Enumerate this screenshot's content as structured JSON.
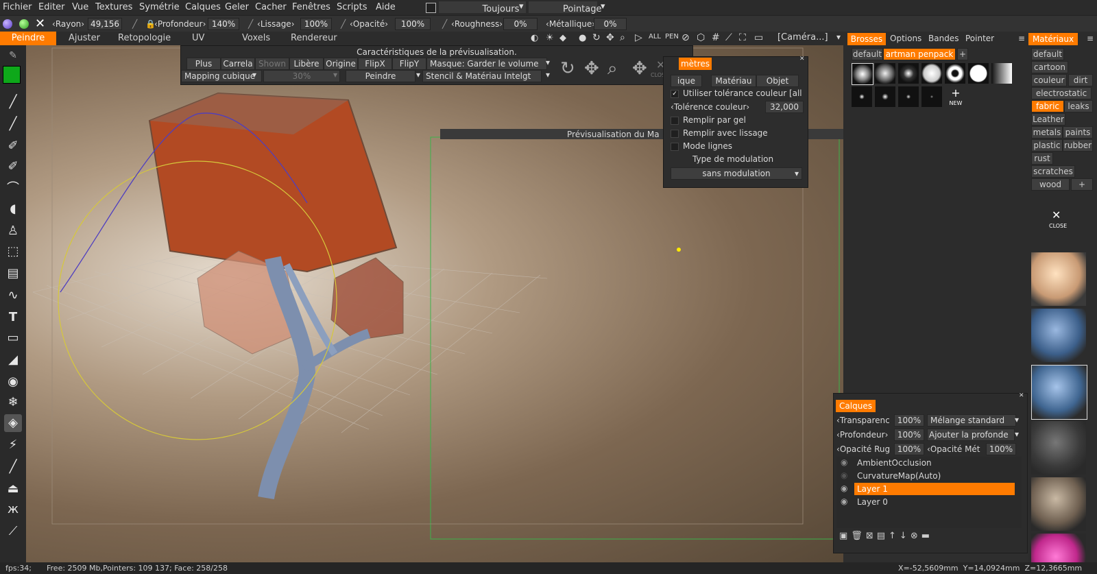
{
  "menu": [
    "Fichier",
    "Editer",
    "Vue",
    "Textures",
    "Symétrie",
    "Calques",
    "Geler",
    "Cacher",
    "Fenêtres",
    "Scripts",
    "Aide"
  ],
  "menu_right": {
    "always": "Toujours",
    "pointing": "Pointage"
  },
  "toolbar": {
    "radius_label": "Rayon",
    "radius_value": "49,156",
    "depth_label": "Profondeur",
    "depth_value": "140%",
    "smooth_label": "Lissage",
    "smooth_value": "100%",
    "opacity_label": "Opacité",
    "opacity_value": "100%",
    "roughness_label": "Roughness",
    "roughness_value": "0%",
    "metal_label": "Métallique",
    "metal_value": "0%"
  },
  "tabs": [
    "Peindre",
    "Ajuster",
    "Retopologie",
    "UV",
    "Voxels",
    "Rendereur"
  ],
  "camera": "[Caméra...]",
  "preview_bar": {
    "title": "Caractéristiques de la prévisualisation.",
    "buttons": [
      "Plus",
      "Carrela",
      "Shown",
      "Libère",
      "Origine",
      "FlipX",
      "FlipY"
    ],
    "mask": "Masque: Garder le volume",
    "mapping": "Mapping cubique",
    "percent": "30%",
    "paint": "Peindre",
    "stencil": "Stencil & Matériau Intelgt",
    "close": "CLOSE"
  },
  "params": {
    "tab_title": "mètres",
    "tabs": [
      "ique",
      "Matériau",
      "Objet"
    ],
    "use_tolerance": "Utiliser tolérance couleur [all",
    "tolerance_label": "Tolérence couleur",
    "tolerance_value": "32,000",
    "fill_freeze": "Remplir par gel",
    "fill_smooth": "Remplir avec lissage",
    "lines_mode": "Mode lignes",
    "modulation_label": "Type de modulation",
    "modulation_value": "sans modulation"
  },
  "preview_window_title": "Prévisualisation du Ma",
  "brushes": {
    "tabs": [
      "Brosses",
      "Options",
      "Bandes",
      "Pointer"
    ],
    "packs": [
      "default",
      "artman penpack"
    ],
    "new_label": "NEW"
  },
  "materials": {
    "title": "Matériaux",
    "items": [
      "default",
      "cartoon",
      "couleur",
      "dirt",
      "electrostatic",
      "fabric",
      "leaks",
      "Leather",
      "metals",
      "paints",
      "plastic",
      "rubber",
      "rust",
      "scratches",
      "wood"
    ],
    "close": "CLOSE"
  },
  "layers": {
    "title": "Calques",
    "rows": [
      {
        "label": "Transparenc",
        "value": "100%",
        "option": "Mélange standard"
      },
      {
        "label": "Profondeur",
        "value": "100%",
        "option": "Ajouter la profonde"
      },
      {
        "label": "Opacité Rug",
        "value": "100%",
        "option": "Opacité Mét",
        "value2": "100%"
      }
    ],
    "items": [
      "AmbientOcclusion",
      "CurvatureMap(Auto)",
      "Layer 1",
      "Layer 0"
    ],
    "selected": "Layer 1"
  },
  "status": {
    "fps": "fps:34;",
    "free": "Free: 2509 Mb,Pointers: 109 137; Face: 258/258",
    "coords": "X=-52,5609mm  Y=14,0924mm  Z=12,3665mm"
  },
  "colors": {
    "accent": "#ff7b00",
    "swatch": "#0ea81a"
  }
}
